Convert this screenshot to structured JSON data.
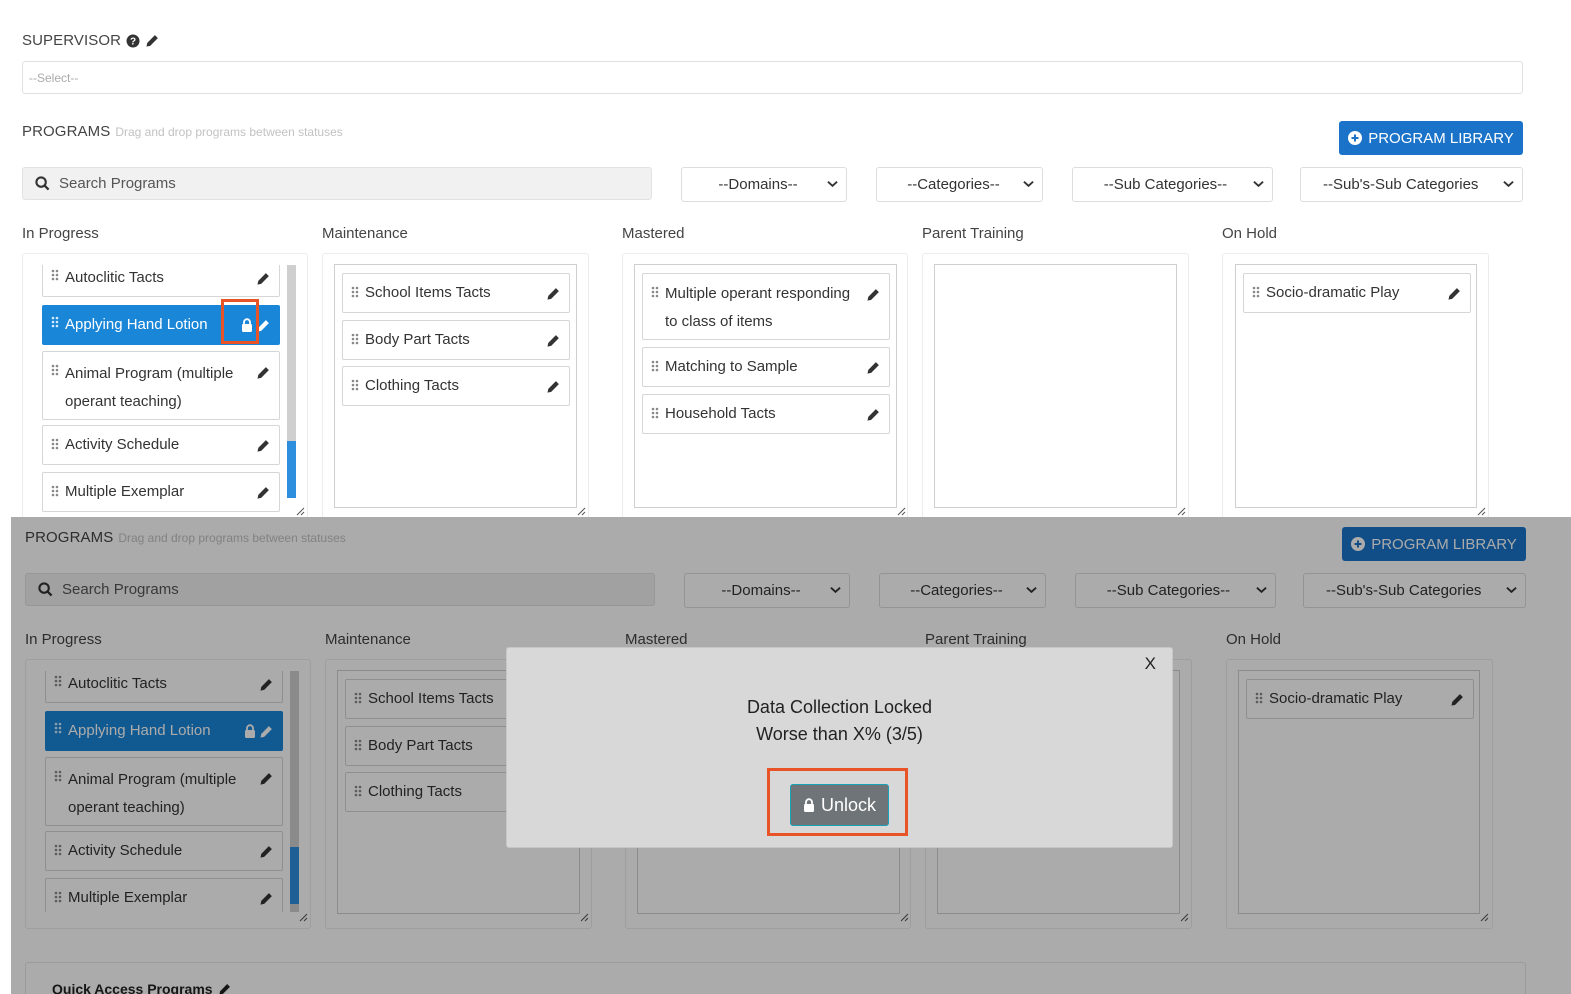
{
  "supervisor": {
    "label": "SUPERVISOR",
    "placeholder": "--Select--"
  },
  "programs": {
    "label": "PROGRAMS",
    "hint": "Drag and drop programs between statuses",
    "library_button": "PROGRAM LIBRARY",
    "search_placeholder": "Search Programs",
    "filters": [
      "--Domains--",
      "--Categories--",
      "--Sub Categories--",
      "--Sub's-Sub Categories"
    ]
  },
  "columns": [
    {
      "title": "In Progress",
      "items": [
        "Autoclitic Tacts",
        "Applying Hand Lotion",
        "Animal Program (multiple operant teaching)",
        "Activity Schedule",
        "Multiple Exemplar"
      ]
    },
    {
      "title": "Maintenance",
      "items": [
        "School Items Tacts",
        "Body Part Tacts",
        "Clothing Tacts"
      ]
    },
    {
      "title": "Mastered",
      "items": [
        "Multiple operant responding to class of items",
        "Matching to Sample",
        "Household Tacts"
      ]
    },
    {
      "title": "Parent Training",
      "items": []
    },
    {
      "title": "On Hold",
      "items": [
        "Socio-dramatic Play"
      ]
    }
  ],
  "modal": {
    "close": "X",
    "line1": "Data Collection Locked",
    "line2": "Worse than X% (3/5)",
    "unlock_label": "Unlock"
  },
  "quick_access": {
    "label": "Quick Access Programs"
  },
  "colors": {
    "primary": "#1a73c8",
    "selected": "#1a86d8",
    "highlight": "#e85428",
    "unlock": "#6f7478"
  },
  "icons": [
    "question-circle-icon",
    "pencil-icon",
    "plus-circle-icon",
    "search-icon",
    "chevron-down-icon",
    "grip-icon",
    "lock-icon",
    "close-icon"
  ]
}
